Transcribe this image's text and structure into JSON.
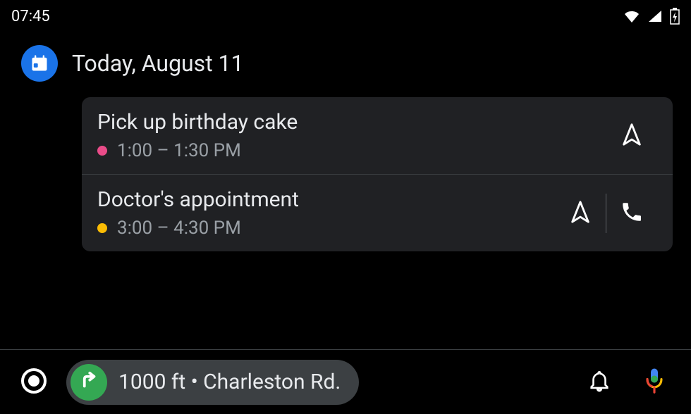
{
  "status_bar": {
    "time": "07:45"
  },
  "header": {
    "title": "Today, August 11"
  },
  "events": [
    {
      "title": "Pick up birthday cake",
      "time": "1:00 – 1:30 PM",
      "dot_color": "#ea4c89",
      "has_nav": true,
      "has_call": false
    },
    {
      "title": "Doctor's appointment",
      "time": "3:00 – 4:30 PM",
      "dot_color": "#fbbc04",
      "has_nav": true,
      "has_call": true
    }
  ],
  "nav_bar": {
    "text": "1000 ft • Charleston Rd."
  },
  "colors": {
    "accent_blue": "#1a73e8",
    "accent_green": "#34a853"
  }
}
